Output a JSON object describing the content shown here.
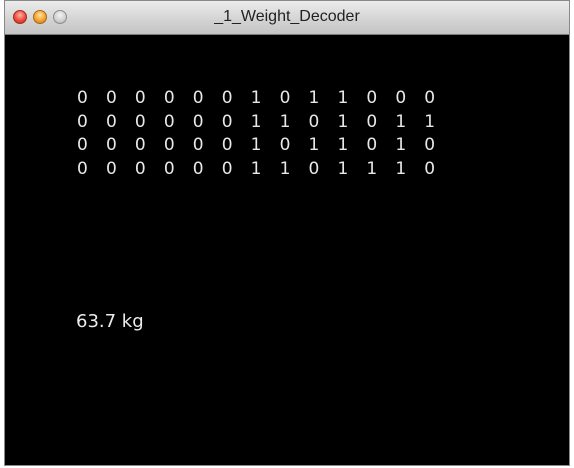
{
  "window": {
    "title": "_1_Weight_Decoder"
  },
  "bit_rows": [
    [
      "0",
      "0",
      "0",
      "0",
      "0",
      "0",
      "1",
      "0",
      "1",
      "1",
      "0",
      "0",
      "0"
    ],
    [
      "0",
      "0",
      "0",
      "0",
      "0",
      "0",
      "1",
      "1",
      "0",
      "1",
      "0",
      "1",
      "1"
    ],
    [
      "0",
      "0",
      "0",
      "0",
      "0",
      "0",
      "1",
      "0",
      "1",
      "1",
      "0",
      "1",
      "0"
    ],
    [
      "0",
      "0",
      "0",
      "0",
      "0",
      "0",
      "1",
      "1",
      "0",
      "1",
      "1",
      "1",
      "0"
    ]
  ],
  "weight_text": "63.7 kg",
  "colors": {
    "canvas_background": "#000000",
    "text": "#e8e8e8"
  }
}
